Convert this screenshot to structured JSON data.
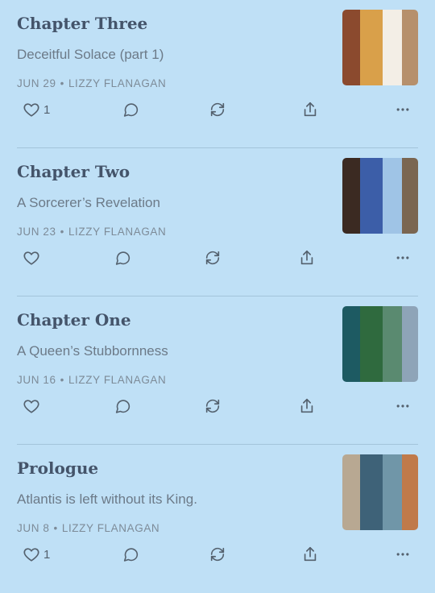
{
  "posts": [
    {
      "title": "Chapter Three",
      "subtitle": "Deceitful Solace (part 1)",
      "date": "JUN 29",
      "author": "LIZZY FLANAGAN",
      "likes": "1",
      "thumb_colors": [
        "#8b4a2e",
        "#d9a04a",
        "#f3eee6",
        "#b6906c"
      ]
    },
    {
      "title": "Chapter Two",
      "subtitle": "A Sorcerer’s Revelation",
      "date": "JUN 23",
      "author": "LIZZY FLANAGAN",
      "likes": "",
      "thumb_colors": [
        "#3b2a22",
        "#3c5ea8",
        "#9fc4e6",
        "#7a6651"
      ]
    },
    {
      "title": "Chapter One",
      "subtitle": "A Queen’s Stubbornness",
      "date": "JUN 16",
      "author": "LIZZY FLANAGAN",
      "likes": "",
      "thumb_colors": [
        "#1d5a62",
        "#2f6a3e",
        "#5a8a70",
        "#8ea4b8"
      ]
    },
    {
      "title": "Prologue",
      "subtitle": "Atlantis is left without its King.",
      "date": "JUN 8",
      "author": "LIZZY FLANAGAN",
      "likes": "1",
      "thumb_colors": [
        "#b8a892",
        "#3e6278",
        "#7096a8",
        "#c07a4a"
      ]
    }
  ],
  "icons": {
    "like": "heart-icon",
    "comment": "comment-icon",
    "restack": "restack-icon",
    "share": "share-icon",
    "more": "more-icon"
  },
  "meta_separator": "•"
}
